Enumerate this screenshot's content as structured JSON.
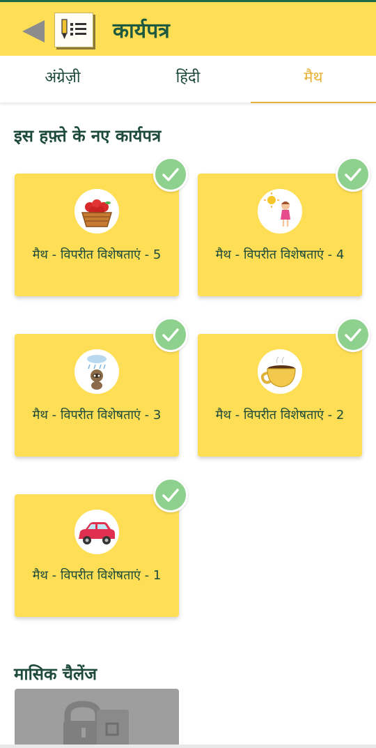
{
  "header": {
    "title": "कार्यपत्र",
    "back_icon": "back-arrow-icon",
    "app_icon": "worksheet-icon"
  },
  "tabs": [
    {
      "label": "अंग्रेज़ी",
      "active": false
    },
    {
      "label": "हिंदी",
      "active": false
    },
    {
      "label": "मैथ",
      "active": true
    }
  ],
  "sections": {
    "new_this_week": "इस हफ़्ते के नए कार्यपत्र",
    "monthly_challenge": "मासिक चैलेंज"
  },
  "worksheets": [
    {
      "title": "मैथ - विपरीत विशेषताएं - 5",
      "image": "apple-basket-icon",
      "completed": true
    },
    {
      "title": "मैथ - विपरीत विशेषताएं - 4",
      "image": "girl-sun-icon",
      "completed": true
    },
    {
      "title": "मैथ - विपरीत विशेषताएं - 3",
      "image": "raccoon-rain-icon",
      "completed": true
    },
    {
      "title": "मैथ - विपरीत विशेषताएं - 2",
      "image": "tea-cup-icon",
      "completed": true
    },
    {
      "title": "मैथ - विपरीत विशेषताएं - 1",
      "image": "red-car-icon",
      "completed": true
    }
  ],
  "monthly_challenge": {
    "locked": true,
    "icon": "lock-icon"
  },
  "colors": {
    "header_bg": "#fdde55",
    "card_bg": "#fdde55",
    "text": "#1e4a3a",
    "active_tab": "#e8b23a",
    "check": "#8ed08e",
    "locked": "#9e9e9e"
  }
}
